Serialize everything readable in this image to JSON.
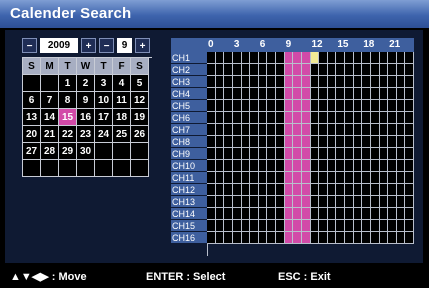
{
  "window": {
    "title": "Calender Search"
  },
  "calendar": {
    "prev_year": "−",
    "year": "2009",
    "next_year": "+",
    "prev_month": "−",
    "month": "9",
    "next_month": "+",
    "weekdays": [
      "S",
      "M",
      "T",
      "W",
      "T",
      "F",
      "S"
    ],
    "days": [
      "",
      "",
      "1",
      "2",
      "3",
      "4",
      "5",
      "6",
      "7",
      "8",
      "9",
      "10",
      "11",
      "12",
      "13",
      "14",
      "15",
      "16",
      "17",
      "18",
      "19",
      "20",
      "21",
      "22",
      "23",
      "24",
      "25",
      "26",
      "27",
      "28",
      "29",
      "30",
      "",
      "",
      "",
      "",
      "",
      "",
      "",
      "",
      "",
      ""
    ],
    "selected_day": "15"
  },
  "timeline": {
    "hour_labels": [
      {
        "hour": 0,
        "label": "0"
      },
      {
        "hour": 3,
        "label": "3"
      },
      {
        "hour": 6,
        "label": "6"
      },
      {
        "hour": 9,
        "label": "9"
      },
      {
        "hour": 12,
        "label": "12"
      },
      {
        "hour": 15,
        "label": "15"
      },
      {
        "hour": 18,
        "label": "18"
      },
      {
        "hour": 21,
        "label": "21"
      }
    ],
    "channels": [
      "CH1",
      "CH2",
      "CH3",
      "CH4",
      "CH5",
      "CH6",
      "CH7",
      "CH8",
      "CH9",
      "CH10",
      "CH11",
      "CH12",
      "CH13",
      "CH14",
      "CH15",
      "CH16"
    ],
    "recorded_hours": [
      9,
      10,
      11
    ],
    "cursor": {
      "channel": "CH1",
      "hour": 12
    },
    "colors": {
      "recorded": "#d24aa8",
      "cursor": "#f1ea95",
      "empty": "#000000"
    }
  },
  "footer": {
    "move": "▲▼◀▶ : Move",
    "enter": "ENTER : Select",
    "esc": "ESC : Exit"
  }
}
